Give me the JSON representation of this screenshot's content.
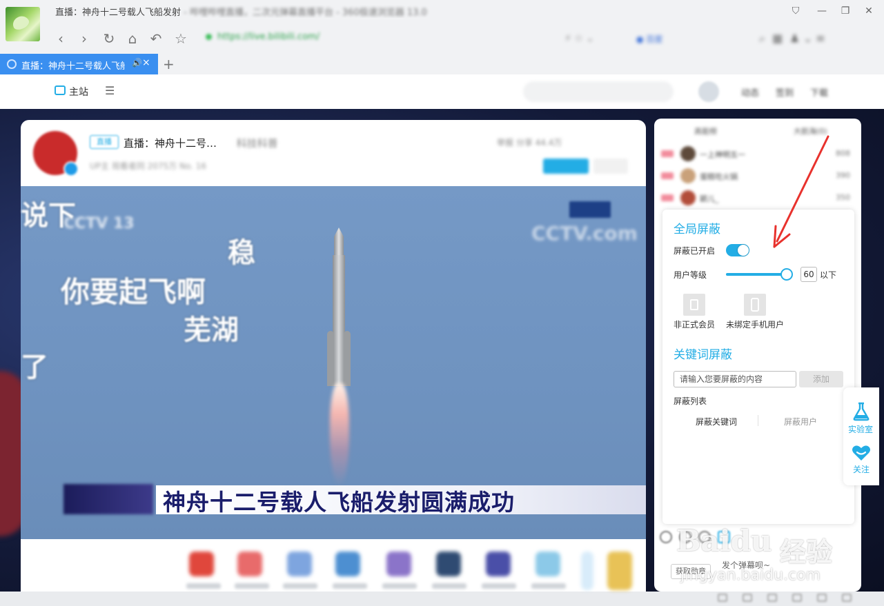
{
  "window": {
    "title": "直播：神舟十二号载人飞船发射",
    "title_blurred_rest": " - 哔哩哔哩直播，二次元弹幕直播平台 - 360极速浏览器 13.0",
    "address": "https://live.bilibili.com/"
  },
  "tab": {
    "label": "直播：神舟十二号载人飞船发",
    "sound": "🔊",
    "close": "×",
    "new_tab": "+"
  },
  "site_nav": {
    "home_label": "主站",
    "menu": "☰",
    "top_links": [
      "动态",
      "签到",
      "下载"
    ]
  },
  "room": {
    "live_badge": "直播",
    "title": "直播：神舟十二号…",
    "title_rest": "科技科普",
    "meta": "UP主  观看者同  2075万  No. 16",
    "actions": "举报   分享   44.4万"
  },
  "video": {
    "danmaku": [
      "说下",
      "稳",
      "你要起飞啊",
      "芜湖",
      "了"
    ],
    "channel_logo_left": "CCTV 13",
    "channel_logo_right": "CCTV.com",
    "news_headline": "神舟十二号载人飞船发射圆满成功"
  },
  "shield_panel": {
    "global_title": "全局屏蔽",
    "enabled_label": "屏蔽已开启",
    "enabled": true,
    "level_label": "用户等级",
    "level_value": "60",
    "level_suffix": "以下",
    "level_fraction": 1.0,
    "nonmember_label": "非正式会员",
    "nophone_label": "未绑定手机用户",
    "keyword_title": "关键词屏蔽",
    "keyword_placeholder": "请输入您要屏蔽的内容",
    "add_label": "添加",
    "list_label": "屏蔽列表",
    "tab_keywords": "屏蔽关键词",
    "tab_users": "屏蔽用户"
  },
  "rank": {
    "header_left": "高能榜",
    "header_right": "大航海(0)",
    "rows": [
      {
        "name": "一上神明五一",
        "score": "808"
      },
      {
        "name": "蛋糕吃火锅",
        "score": "390"
      },
      {
        "name": "颖儿_",
        "score": "350"
      }
    ]
  },
  "dock": {
    "lab_label": "实验室",
    "follow_label": "关注"
  },
  "chat": {
    "medal_button": "获取勋章",
    "placeholder": "发个弹幕呗~"
  },
  "watermark": {
    "brand": "Baidu",
    "cn": "经验",
    "url": "jingyan.baidu.com"
  },
  "colors": {
    "accent": "#23ade5",
    "tab_active": "#3a8ff0",
    "arrow": "#e8322d"
  }
}
